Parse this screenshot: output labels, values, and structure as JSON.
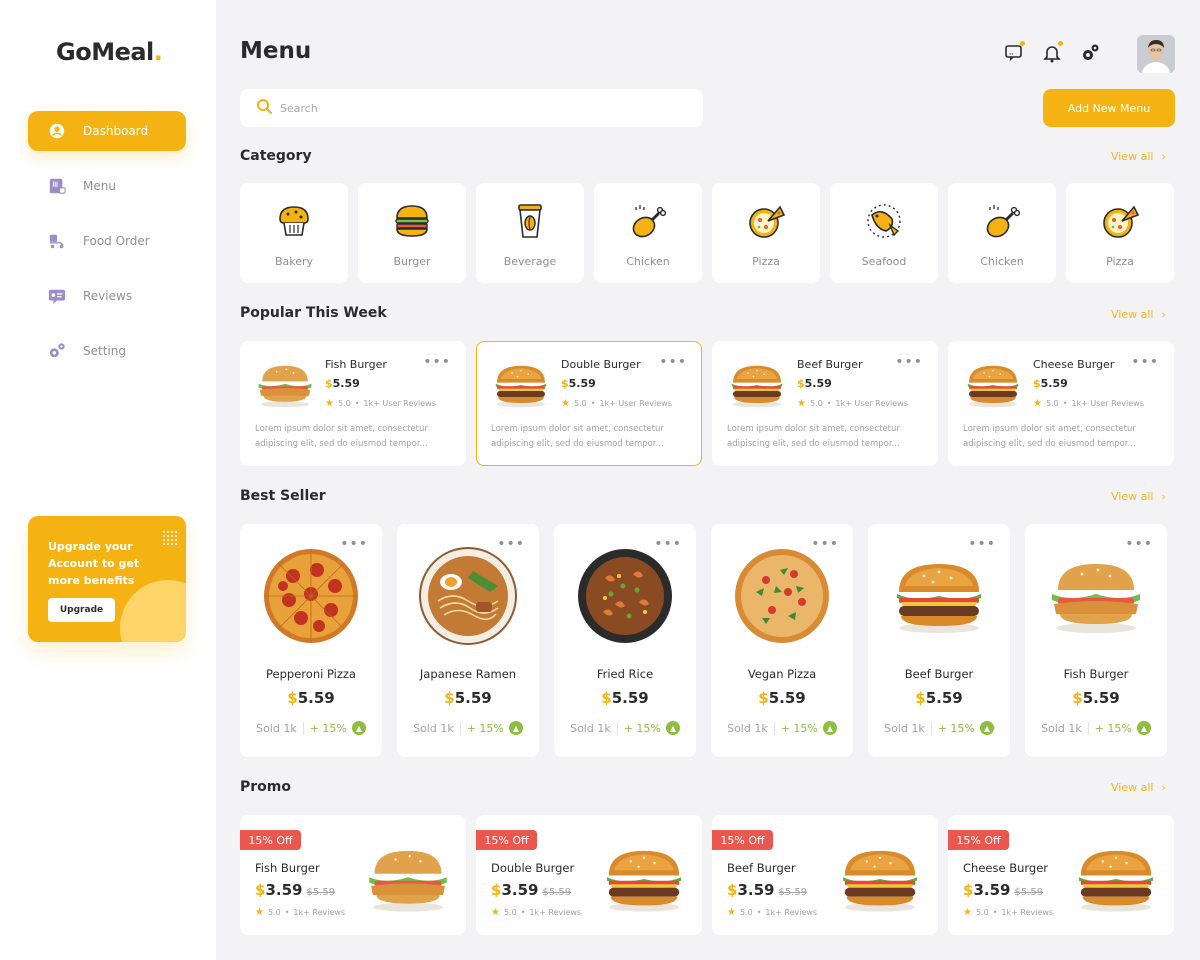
{
  "brand": {
    "name": "GoMeal",
    "dot": ".",
    "accent": "#f5b313"
  },
  "sidebar": {
    "items": [
      {
        "label": "Dashboard",
        "icon": "dashboard-icon",
        "active": true
      },
      {
        "label": "Menu",
        "icon": "menu-icon"
      },
      {
        "label": "Food Order",
        "icon": "food-order-icon"
      },
      {
        "label": "Reviews",
        "icon": "reviews-icon"
      },
      {
        "label": "Setting",
        "icon": "setting-icon"
      }
    ],
    "upgrade": {
      "text": "Upgrade your Account to get more benefits",
      "button": "Upgrade"
    }
  },
  "header": {
    "title": "Menu",
    "icons": [
      "chat-icon",
      "bell-icon",
      "gear-icon"
    ],
    "search_placeholder": "Search",
    "add_button": "Add New Menu"
  },
  "category": {
    "title": "Category",
    "view_all": "View all",
    "items": [
      {
        "label": "Bakery",
        "icon": "bakery-icon"
      },
      {
        "label": "Burger",
        "icon": "burger-icon"
      },
      {
        "label": "Beverage",
        "icon": "beverage-icon"
      },
      {
        "label": "Chicken",
        "icon": "chicken-icon"
      },
      {
        "label": "Pizza",
        "icon": "pizza-icon"
      },
      {
        "label": "Seafood",
        "icon": "seafood-icon"
      },
      {
        "label": "Chicken",
        "icon": "chicken-icon"
      },
      {
        "label": "Pizza",
        "icon": "pizza-icon"
      }
    ]
  },
  "popular": {
    "title": "Popular This Week",
    "view_all": "View all",
    "items": [
      {
        "name": "Fish Burger",
        "currency": "$",
        "price": "5.59",
        "rating": "5.0",
        "reviews": "1k+ User Reviews",
        "desc1": "Lorem ipsum dolor sit amet, consectetur",
        "desc2": "adipiscing elit, sed do eiusmod tempor...",
        "selected": false
      },
      {
        "name": "Double Burger",
        "currency": "$",
        "price": "5.59",
        "rating": "5.0",
        "reviews": "1k+ User Reviews",
        "desc1": "Lorem ipsum dolor sit amet, consectetur",
        "desc2": "adipiscing elit, sed do eiusmod tempor...",
        "selected": true
      },
      {
        "name": "Beef Burger",
        "currency": "$",
        "price": "5.59",
        "rating": "5.0",
        "reviews": "1k+ User Reviews",
        "desc1": "Lorem ipsum dolor sit amet, consectetur",
        "desc2": "adipiscing elit, sed do eiusmod tempor...",
        "selected": false
      },
      {
        "name": "Cheese Burger",
        "currency": "$",
        "price": "5.59",
        "rating": "5.0",
        "reviews": "1k+ User Reviews",
        "desc1": "Lorem ipsum dolor sit amet, consectetur",
        "desc2": "adipiscing elit, sed do eiusmod tempor...",
        "selected": false
      }
    ]
  },
  "best_seller": {
    "title": "Best Seller",
    "view_all": "View all",
    "items": [
      {
        "name": "Pepperoni Pizza",
        "currency": "$",
        "price": "5.59",
        "sold": "Sold 1k",
        "change": "+ 15%"
      },
      {
        "name": "Japanese Ramen",
        "currency": "$",
        "price": "5.59",
        "sold": "Sold 1k",
        "change": "+ 15%"
      },
      {
        "name": "Fried Rice",
        "currency": "$",
        "price": "5.59",
        "sold": "Sold 1k",
        "change": "+ 15%"
      },
      {
        "name": "Vegan Pizza",
        "currency": "$",
        "price": "5.59",
        "sold": "Sold 1k",
        "change": "+ 15%"
      },
      {
        "name": "Beef Burger",
        "currency": "$",
        "price": "5.59",
        "sold": "Sold 1k",
        "change": "+ 15%"
      },
      {
        "name": "Fish Burger",
        "currency": "$",
        "price": "5.59",
        "sold": "Sold 1k",
        "change": "+ 15%"
      }
    ]
  },
  "promo": {
    "title": "Promo",
    "view_all": "View all",
    "items": [
      {
        "tag": "15% Off",
        "name": "Fish Burger",
        "currency": "$",
        "price": "3.59",
        "old_price": "$5.59",
        "rating": "5.0",
        "reviews": "1k+ Reviews"
      },
      {
        "tag": "15% Off",
        "name": "Double Burger",
        "currency": "$",
        "price": "3.59",
        "old_price": "$5.59",
        "rating": "5.0",
        "reviews": "1k+ Reviews"
      },
      {
        "tag": "15% Off",
        "name": "Beef Burger",
        "currency": "$",
        "price": "3.59",
        "old_price": "$5.59",
        "rating": "5.0",
        "reviews": "1k+ Reviews"
      },
      {
        "tag": "15% Off",
        "name": "Cheese Burger",
        "currency": "$",
        "price": "3.59",
        "old_price": "$5.59",
        "rating": "5.0",
        "reviews": "1k+ Reviews"
      }
    ]
  }
}
